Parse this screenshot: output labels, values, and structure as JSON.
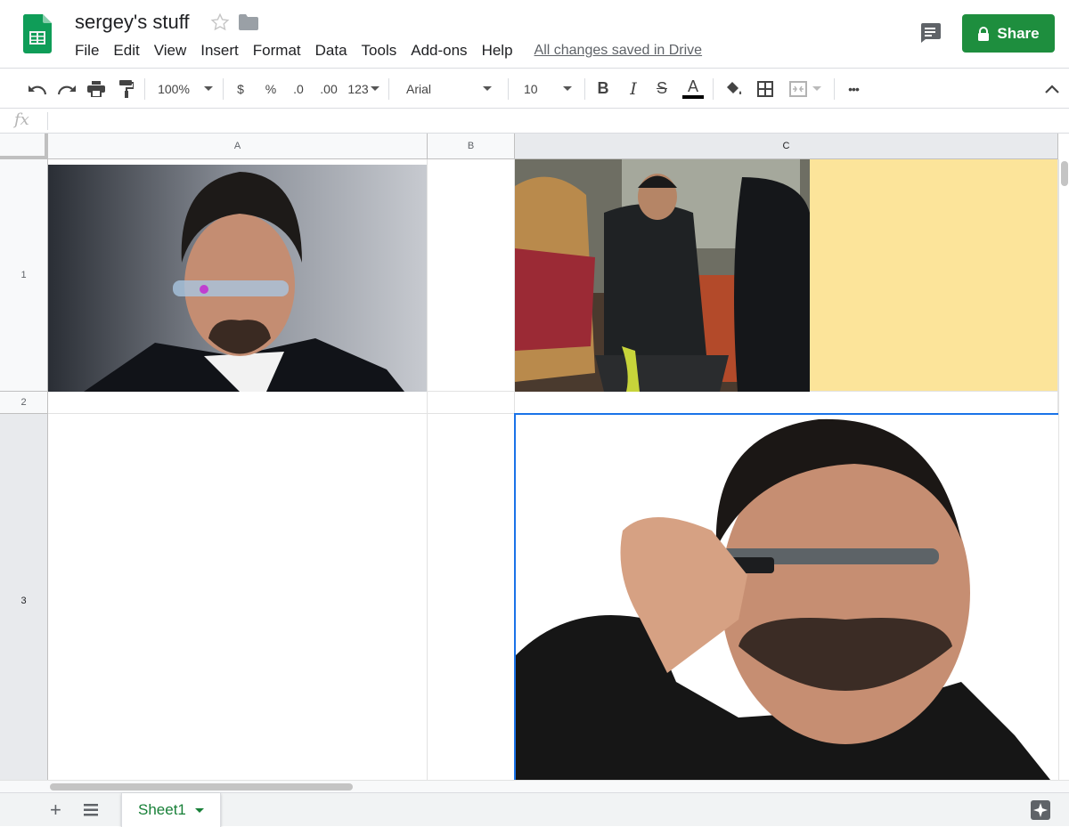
{
  "app": {
    "doc_title": "sergey's stuff",
    "menu": [
      "File",
      "Edit",
      "View",
      "Insert",
      "Format",
      "Data",
      "Tools",
      "Add-ons",
      "Help"
    ],
    "save_status": "All changes saved in Drive",
    "share_label": "Share",
    "accent": "#1e8e3e"
  },
  "toolbar": {
    "zoom": "100%",
    "currency": "$",
    "percent": "%",
    "decrease_decimal": ".0",
    "increase_decimal": ".00",
    "number_format": "123",
    "font": "Arial",
    "font_size": "10",
    "bold": "B",
    "italic": "I",
    "strike": "S",
    "text_color": "A",
    "more": "•••"
  },
  "formula_bar": {
    "fx": "fx",
    "value": ""
  },
  "grid": {
    "columns": [
      "A",
      "B",
      "C"
    ],
    "rows": [
      "1",
      "2",
      "3"
    ],
    "selected_column": "C",
    "selected_row": "3",
    "highlight_color": "#fce49a",
    "images": [
      {
        "cell": "A1",
        "subject": "man in suit wearing smart glasses"
      },
      {
        "cell": "C1",
        "subject": "man wearing smart glasses on subway train"
      },
      {
        "cell": "C3",
        "subject": "man adjusting smart glasses"
      }
    ]
  },
  "sheets": {
    "add": "+",
    "tabs": [
      "Sheet1"
    ]
  }
}
